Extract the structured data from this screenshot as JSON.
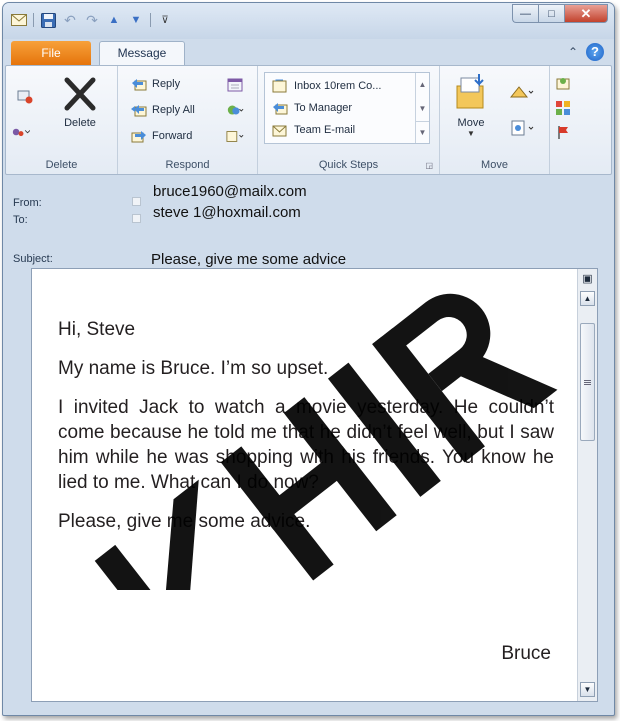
{
  "titlebar": {
    "buttons": {
      "minimize": "—",
      "maximize": "□",
      "close": "✕"
    }
  },
  "tabs": {
    "file": "File",
    "message": "Message"
  },
  "ribbon": {
    "delete_group": {
      "delete_label": "Delete",
      "group_label": "Delete"
    },
    "respond_group": {
      "reply": "Reply",
      "reply_all": "Reply All",
      "forward": "Forward",
      "group_label": "Respond"
    },
    "quick_steps": {
      "items": [
        "Inbox 10rem Co...",
        "To Manager",
        "Team E-mail"
      ],
      "group_label": "Quick Steps"
    },
    "move_group": {
      "move_label": "Move",
      "group_label": "Move"
    }
  },
  "headers": {
    "from_label": "From:",
    "from_value": "bruce1960@mailx.com",
    "to_label": "To:",
    "to_value": "steve 1@hoxmail.com",
    "subject_label": "Subject:",
    "subject_value": "Please, give me some advice"
  },
  "message": {
    "greeting": "Hi, Steve",
    "para1": "My name is Bruce. I’m so upset.",
    "para2": "I invited Jack to watch a movie yesterday. He couldn’t come because he told me that he didn’t feel well, but I saw him while he was shopping with his friends. You know he lied to me. What can I do now?",
    "para3": "Please, give me some advice.",
    "signature": "Bruce"
  },
  "watermark": {
    "text": "KHR",
    "color": "#000000"
  },
  "colors": {
    "file_tab": "#e5740b",
    "help": "#1e62c7",
    "close": "#c2422d"
  }
}
